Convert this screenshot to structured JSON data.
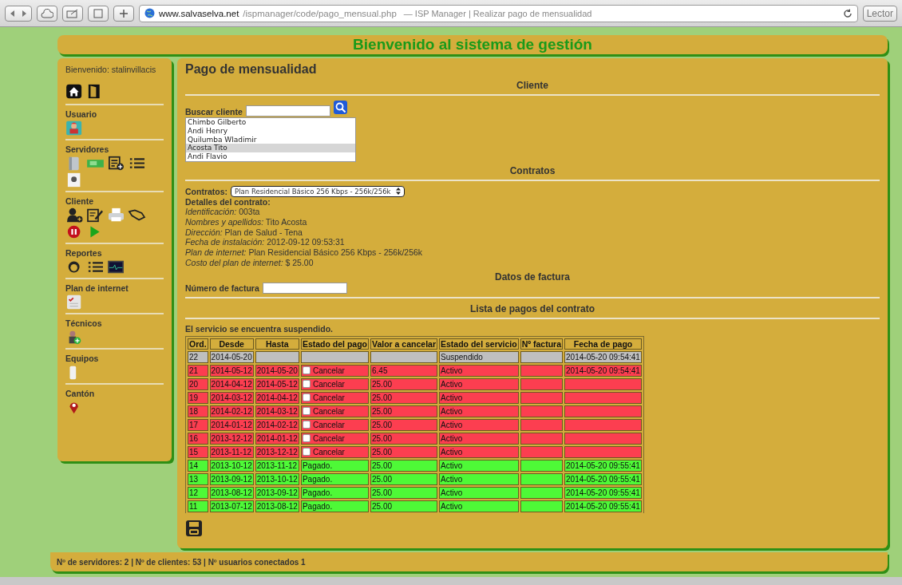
{
  "browser": {
    "url_host": "www.salvaselva.net",
    "url_path": "/ispmanager/code/pago_mensual.php",
    "page_title": "— ISP Manager | Realizar pago de mensualidad",
    "reader_button": "Lector"
  },
  "header": {
    "title": "Bienvenido al sistema de gestión"
  },
  "sidebar": {
    "welcome": "Bienvenido: stalinvillacis",
    "sections": [
      {
        "title": "Usuario"
      },
      {
        "title": "Servidores"
      },
      {
        "title": "Cliente"
      },
      {
        "title": "Reportes"
      },
      {
        "title": "Plan de internet"
      },
      {
        "title": "Técnicos"
      },
      {
        "title": "Equipos"
      },
      {
        "title": "Cantón"
      }
    ]
  },
  "main": {
    "title": "Pago de mensualidad",
    "client_section": {
      "heading": "Cliente",
      "search_label": "Buscar cliente",
      "clients": [
        {
          "name": "Chimbo Gilberto",
          "selected": false
        },
        {
          "name": "Andi Henry",
          "selected": false
        },
        {
          "name": "Quilumba Wladimir",
          "selected": false
        },
        {
          "name": "Acosta Tito",
          "selected": true
        },
        {
          "name": "Andi Flavio",
          "selected": false
        }
      ]
    },
    "contracts_section": {
      "heading": "Contratos",
      "select_label": "Contratos:",
      "select_value": "Plan Residencial Básico 256 Kbps - 256k/256k",
      "details_heading": "Detalles del contrato:",
      "details": [
        "*Identificación:* 003ta",
        "*Nombres y apellidos:* Tito Acosta",
        "*Dirección:* Plan de Salud - Tena",
        "*Fecha de instalación:* 2012-09-12 09:53:31",
        "*Plan de internet:* Plan Residencial Básico 256 Kbps - 256k/256k",
        "*Costo del plan de internet:* $ 25.00"
      ]
    },
    "invoice_section": {
      "heading": "Datos de factura",
      "invoice_label": "Número de factura"
    },
    "payments_section": {
      "heading": "Lista de pagos del contrato",
      "notice": "El servicio se encuentra suspendido.",
      "columns": [
        "Ord.",
        "Desde",
        "Hasta",
        "Estado del pago",
        "Valor a cancelar",
        "Estado del servicio",
        "Nº factura",
        "Fecha de pago"
      ],
      "rows": [
        {
          "kind": "current",
          "ord": "22",
          "desde": "2014-05-20",
          "hasta": "",
          "pago": "",
          "valor": "",
          "servicio": "Suspendido",
          "factura": "",
          "fecha": "2014-05-20 09:54:41"
        },
        {
          "kind": "pending",
          "checked": false,
          "ord": "21",
          "desde": "2014-05-12",
          "hasta": "2014-05-20",
          "pago": "Cancelar",
          "valor": "6.45",
          "servicio": "Activo",
          "factura": "",
          "fecha": "2014-05-20 09:54:41"
        },
        {
          "kind": "pending",
          "checked": false,
          "ord": "20",
          "desde": "2014-04-12",
          "hasta": "2014-05-12",
          "pago": "Cancelar",
          "valor": "25.00",
          "servicio": "Activo",
          "factura": "",
          "fecha": ""
        },
        {
          "kind": "pending",
          "checked": false,
          "ord": "19",
          "desde": "2014-03-12",
          "hasta": "2014-04-12",
          "pago": "Cancelar",
          "valor": "25.00",
          "servicio": "Activo",
          "factura": "",
          "fecha": ""
        },
        {
          "kind": "pending",
          "checked": false,
          "ord": "18",
          "desde": "2014-02-12",
          "hasta": "2014-03-12",
          "pago": "Cancelar",
          "valor": "25.00",
          "servicio": "Activo",
          "factura": "",
          "fecha": ""
        },
        {
          "kind": "pending",
          "checked": false,
          "ord": "17",
          "desde": "2014-01-12",
          "hasta": "2014-02-12",
          "pago": "Cancelar",
          "valor": "25.00",
          "servicio": "Activo",
          "factura": "",
          "fecha": ""
        },
        {
          "kind": "pending",
          "checked": false,
          "ord": "16",
          "desde": "2013-12-12",
          "hasta": "2014-01-12",
          "pago": "Cancelar",
          "valor": "25.00",
          "servicio": "Activo",
          "factura": "",
          "fecha": ""
        },
        {
          "kind": "pending",
          "checked": false,
          "ord": "15",
          "desde": "2013-11-12",
          "hasta": "2013-12-12",
          "pago": "Cancelar",
          "valor": "25.00",
          "servicio": "Activo",
          "factura": "",
          "fecha": ""
        },
        {
          "kind": "paid",
          "ord": "14",
          "desde": "2013-10-12",
          "hasta": "2013-11-12",
          "pago": "Pagado.",
          "valor": "25.00",
          "servicio": "Activo",
          "factura": "",
          "fecha": "2014-05-20 09:55:41"
        },
        {
          "kind": "paid",
          "ord": "13",
          "desde": "2013-09-12",
          "hasta": "2013-10-12",
          "pago": "Pagado.",
          "valor": "25.00",
          "servicio": "Activo",
          "factura": "",
          "fecha": "2014-05-20 09:55:41"
        },
        {
          "kind": "paid",
          "ord": "12",
          "desde": "2013-08-12",
          "hasta": "2013-09-12",
          "pago": "Pagado.",
          "valor": "25.00",
          "servicio": "Activo",
          "factura": "",
          "fecha": "2014-05-20 09:55:41"
        },
        {
          "kind": "paid",
          "ord": "11",
          "desde": "2013-07-12",
          "hasta": "2013-08-12",
          "pago": "Pagado.",
          "valor": "25.00",
          "servicio": "Activo",
          "factura": "",
          "fecha": "2014-05-20 09:55:41"
        }
      ]
    }
  },
  "status_bar": "Nº de servidores: 2 | Nº de clientes: 53 | Nº usuarios conectados 1"
}
